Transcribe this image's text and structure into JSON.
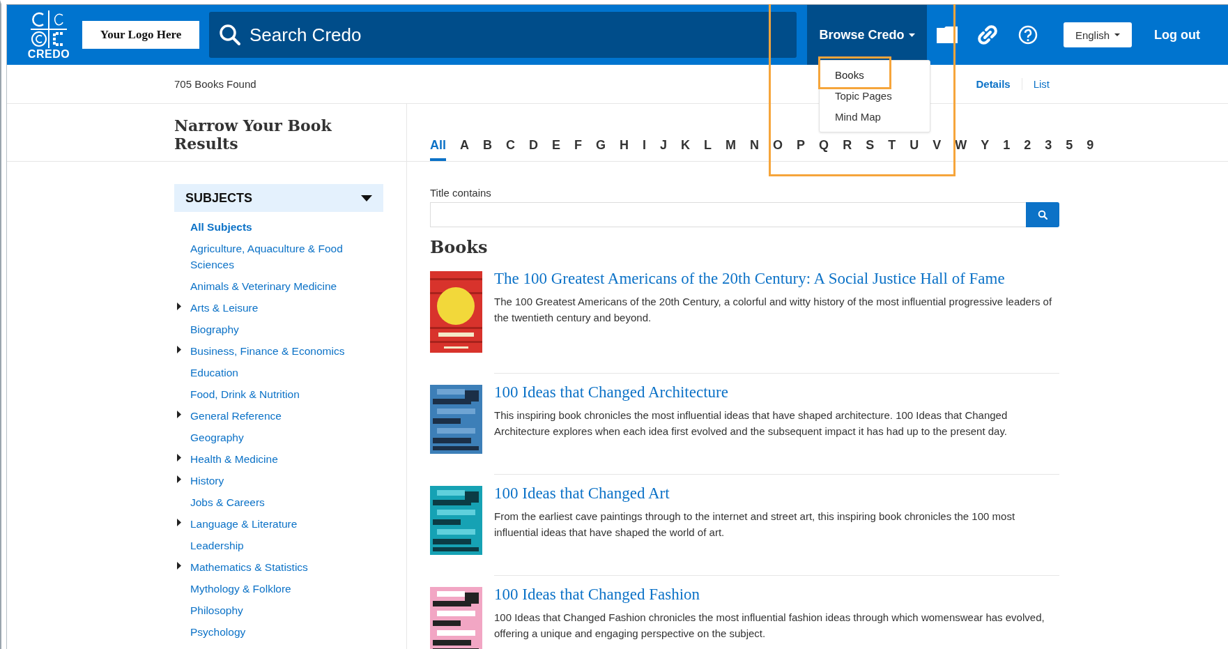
{
  "header": {
    "brand": "CREDO",
    "logo_placeholder": "Your Logo Here",
    "search": {
      "placeholder": "Search Credo"
    },
    "browse": {
      "label": "Browse Credo",
      "expanded": true,
      "menu": [
        {
          "label": "Books",
          "selected": true
        },
        {
          "label": "Topic Pages",
          "selected": false
        },
        {
          "label": "Mind Map",
          "selected": false
        }
      ]
    },
    "language": "English",
    "logout": "Log out"
  },
  "results": {
    "count": "705 Books Found",
    "views": [
      {
        "label": "Details",
        "selected": true
      },
      {
        "label": "List",
        "selected": false
      }
    ]
  },
  "sidebar": {
    "title": "Narrow Your Book Results",
    "facet": {
      "label": "SUBJECTS",
      "expanded": true
    },
    "items": [
      {
        "label": "All Subjects",
        "selected": true,
        "expandable": false
      },
      {
        "label": "Agriculture, Aquaculture & Food Sciences",
        "selected": false,
        "expandable": false
      },
      {
        "label": "Animals & Veterinary Medicine",
        "selected": false,
        "expandable": false
      },
      {
        "label": "Arts & Leisure",
        "selected": false,
        "expandable": true
      },
      {
        "label": "Biography",
        "selected": false,
        "expandable": false
      },
      {
        "label": "Business, Finance & Economics",
        "selected": false,
        "expandable": true
      },
      {
        "label": "Education",
        "selected": false,
        "expandable": false
      },
      {
        "label": "Food, Drink & Nutrition",
        "selected": false,
        "expandable": false
      },
      {
        "label": "General Reference",
        "selected": false,
        "expandable": true
      },
      {
        "label": "Geography",
        "selected": false,
        "expandable": false
      },
      {
        "label": "Health & Medicine",
        "selected": false,
        "expandable": true
      },
      {
        "label": "History",
        "selected": false,
        "expandable": true
      },
      {
        "label": "Jobs & Careers",
        "selected": false,
        "expandable": false
      },
      {
        "label": "Language & Literature",
        "selected": false,
        "expandable": true
      },
      {
        "label": "Leadership",
        "selected": false,
        "expandable": false
      },
      {
        "label": "Mathematics & Statistics",
        "selected": false,
        "expandable": true
      },
      {
        "label": "Mythology & Folklore",
        "selected": false,
        "expandable": false
      },
      {
        "label": "Philosophy",
        "selected": false,
        "expandable": false
      },
      {
        "label": "Psychology",
        "selected": false,
        "expandable": false
      }
    ]
  },
  "alphabet": [
    {
      "label": "All",
      "selected": true
    },
    {
      "label": "A",
      "selected": false
    },
    {
      "label": "B",
      "selected": false
    },
    {
      "label": "C",
      "selected": false
    },
    {
      "label": "D",
      "selected": false
    },
    {
      "label": "E",
      "selected": false
    },
    {
      "label": "F",
      "selected": false
    },
    {
      "label": "G",
      "selected": false
    },
    {
      "label": "H",
      "selected": false
    },
    {
      "label": "I",
      "selected": false
    },
    {
      "label": "J",
      "selected": false
    },
    {
      "label": "K",
      "selected": false
    },
    {
      "label": "L",
      "selected": false
    },
    {
      "label": "M",
      "selected": false
    },
    {
      "label": "N",
      "selected": false
    },
    {
      "label": "O",
      "selected": false
    },
    {
      "label": "P",
      "selected": false
    },
    {
      "label": "Q",
      "selected": false
    },
    {
      "label": "R",
      "selected": false
    },
    {
      "label": "S",
      "selected": false
    },
    {
      "label": "T",
      "selected": false
    },
    {
      "label": "U",
      "selected": false
    },
    {
      "label": "V",
      "selected": false
    },
    {
      "label": "W",
      "selected": false
    },
    {
      "label": "Y",
      "selected": false
    },
    {
      "label": "1",
      "selected": false
    },
    {
      "label": "2",
      "selected": false
    },
    {
      "label": "3",
      "selected": false
    },
    {
      "label": "5",
      "selected": false
    },
    {
      "label": "9",
      "selected": false
    }
  ],
  "filter": {
    "label": "Title contains"
  },
  "books_heading": "Books",
  "books": [
    {
      "title": "The 100 Greatest Americans of the 20th Century: A Social Justice Hall of Fame",
      "description": "The 100 Greatest Americans of the 20th Century, a colorful and witty history of the most influential progressive leaders of the twentieth century and beyond."
    },
    {
      "title": "100 Ideas that Changed Architecture",
      "description": "This inspiring book chronicles the most influential ideas that have shaped architecture. 100 Ideas that Changed Architecture explores when each idea first evolved and the subsequent impact it has had up to the present day."
    },
    {
      "title": "100 Ideas that Changed Art",
      "description": "From the earliest cave paintings through to the internet and street art, this inspiring book chronicles the 100 most influential ideas that have shaped the world of art."
    },
    {
      "title": "100 Ideas that Changed Fashion",
      "description": "100 Ideas that Changed Fashion chronicles the most influential fashion ideas through which womenswear has evolved, offering a unique and engaging perspective on the subject."
    }
  ]
}
